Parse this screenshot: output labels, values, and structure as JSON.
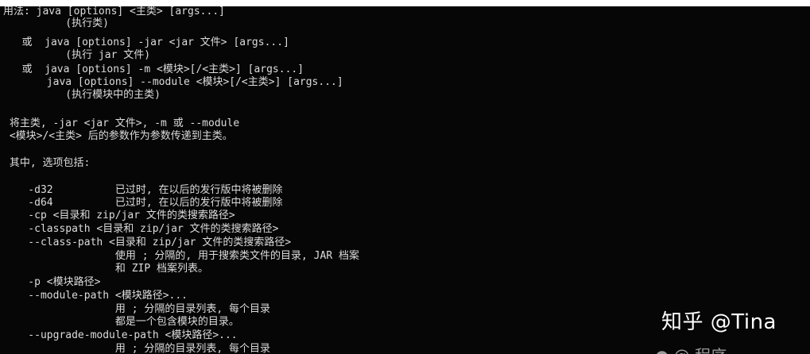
{
  "terminal": {
    "lines": [
      {
        "text": "用法: java [options] <主类> [args...]"
      },
      {
        "text": "          (执行类)"
      },
      {
        "text": "   或  java [options] -jar <jar 文件> [args...]"
      },
      {
        "text": "          (执行 jar 文件)"
      },
      {
        "text": "   或  java [options] -m <模块>[/<主类>] [args...]"
      },
      {
        "text": "       java [options] --module <模块>[/<主类>] [args...]"
      },
      {
        "text": "          (执行模块中的主类)"
      },
      {
        "text": ""
      },
      {
        "text": " 将主类, -jar <jar 文件>, -m 或 --module"
      },
      {
        "text": " <模块>/<主类> 后的参数作为参数传递到主类。"
      },
      {
        "text": ""
      },
      {
        "text": " 其中, 选项包括:"
      },
      {
        "text": ""
      },
      {
        "text": "    -d32          已过时, 在以后的发行版中将被删除"
      },
      {
        "text": "    -d64          已过时, 在以后的发行版中将被删除"
      },
      {
        "text": "    -cp <目录和 zip/jar 文件的类搜索路径>"
      },
      {
        "text": "    -classpath <目录和 zip/jar 文件的类搜索路径>"
      },
      {
        "text": "    --class-path <目录和 zip/jar 文件的类搜索路径>"
      },
      {
        "text": "                  使用 ; 分隔的, 用于搜索类文件的目录, JAR 档案"
      },
      {
        "text": "                  和 ZIP 档案列表。"
      },
      {
        "text": "    -p <模块路径>"
      },
      {
        "text": "    --module-path <模块路径>..."
      },
      {
        "text": "                  用 ; 分隔的目录列表, 每个目录"
      },
      {
        "text": "                  都是一个包含模块的目录。"
      },
      {
        "text": "    --upgrade-module-path <模块路径>..."
      },
      {
        "text": "                  用 ; 分隔的目录列表, 每个目录"
      }
    ]
  },
  "watermark": {
    "text": "知乎 @Tina",
    "sub_text": "● @ 程序"
  }
}
